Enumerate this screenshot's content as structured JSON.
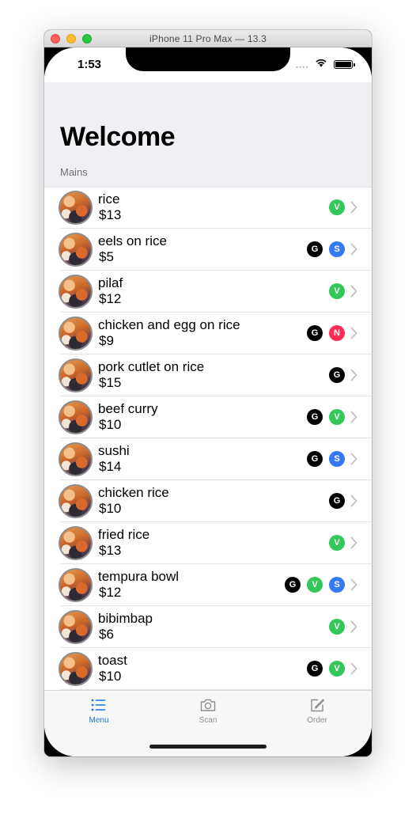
{
  "window": {
    "title": "iPhone 11 Pro Max — 13.3"
  },
  "status_bar": {
    "time": "1:53"
  },
  "nav": {
    "title": "Welcome",
    "section_header": "Mains"
  },
  "colors": {
    "G": "#000000",
    "V": "#34c759",
    "S": "#3478f6",
    "N": "#ff2d55",
    "tab_active": "#1a73e8",
    "tab_inactive": "#8e8e93"
  },
  "items": [
    {
      "name": "rice",
      "price": "$13",
      "badges": [
        "V"
      ]
    },
    {
      "name": "eels on rice",
      "price": "$5",
      "badges": [
        "G",
        "S"
      ]
    },
    {
      "name": "pilaf",
      "price": "$12",
      "badges": [
        "V"
      ]
    },
    {
      "name": "chicken and egg on rice",
      "price": "$9",
      "badges": [
        "G",
        "N"
      ]
    },
    {
      "name": "pork cutlet on rice",
      "price": "$15",
      "badges": [
        "G"
      ]
    },
    {
      "name": "beef curry",
      "price": "$10",
      "badges": [
        "G",
        "V"
      ]
    },
    {
      "name": "sushi",
      "price": "$14",
      "badges": [
        "G",
        "S"
      ]
    },
    {
      "name": "chicken rice",
      "price": "$10",
      "badges": [
        "G"
      ]
    },
    {
      "name": "fried rice",
      "price": "$13",
      "badges": [
        "V"
      ]
    },
    {
      "name": "tempura bowl",
      "price": "$12",
      "badges": [
        "G",
        "V",
        "S"
      ]
    },
    {
      "name": "bibimbap",
      "price": "$6",
      "badges": [
        "V"
      ]
    },
    {
      "name": "toast",
      "price": "$10",
      "badges": [
        "G",
        "V"
      ]
    }
  ],
  "tabs": [
    {
      "label": "Menu",
      "icon": "list-icon",
      "active": true
    },
    {
      "label": "Scan",
      "icon": "camera-icon",
      "active": false
    },
    {
      "label": "Order",
      "icon": "compose-icon",
      "active": false
    }
  ]
}
